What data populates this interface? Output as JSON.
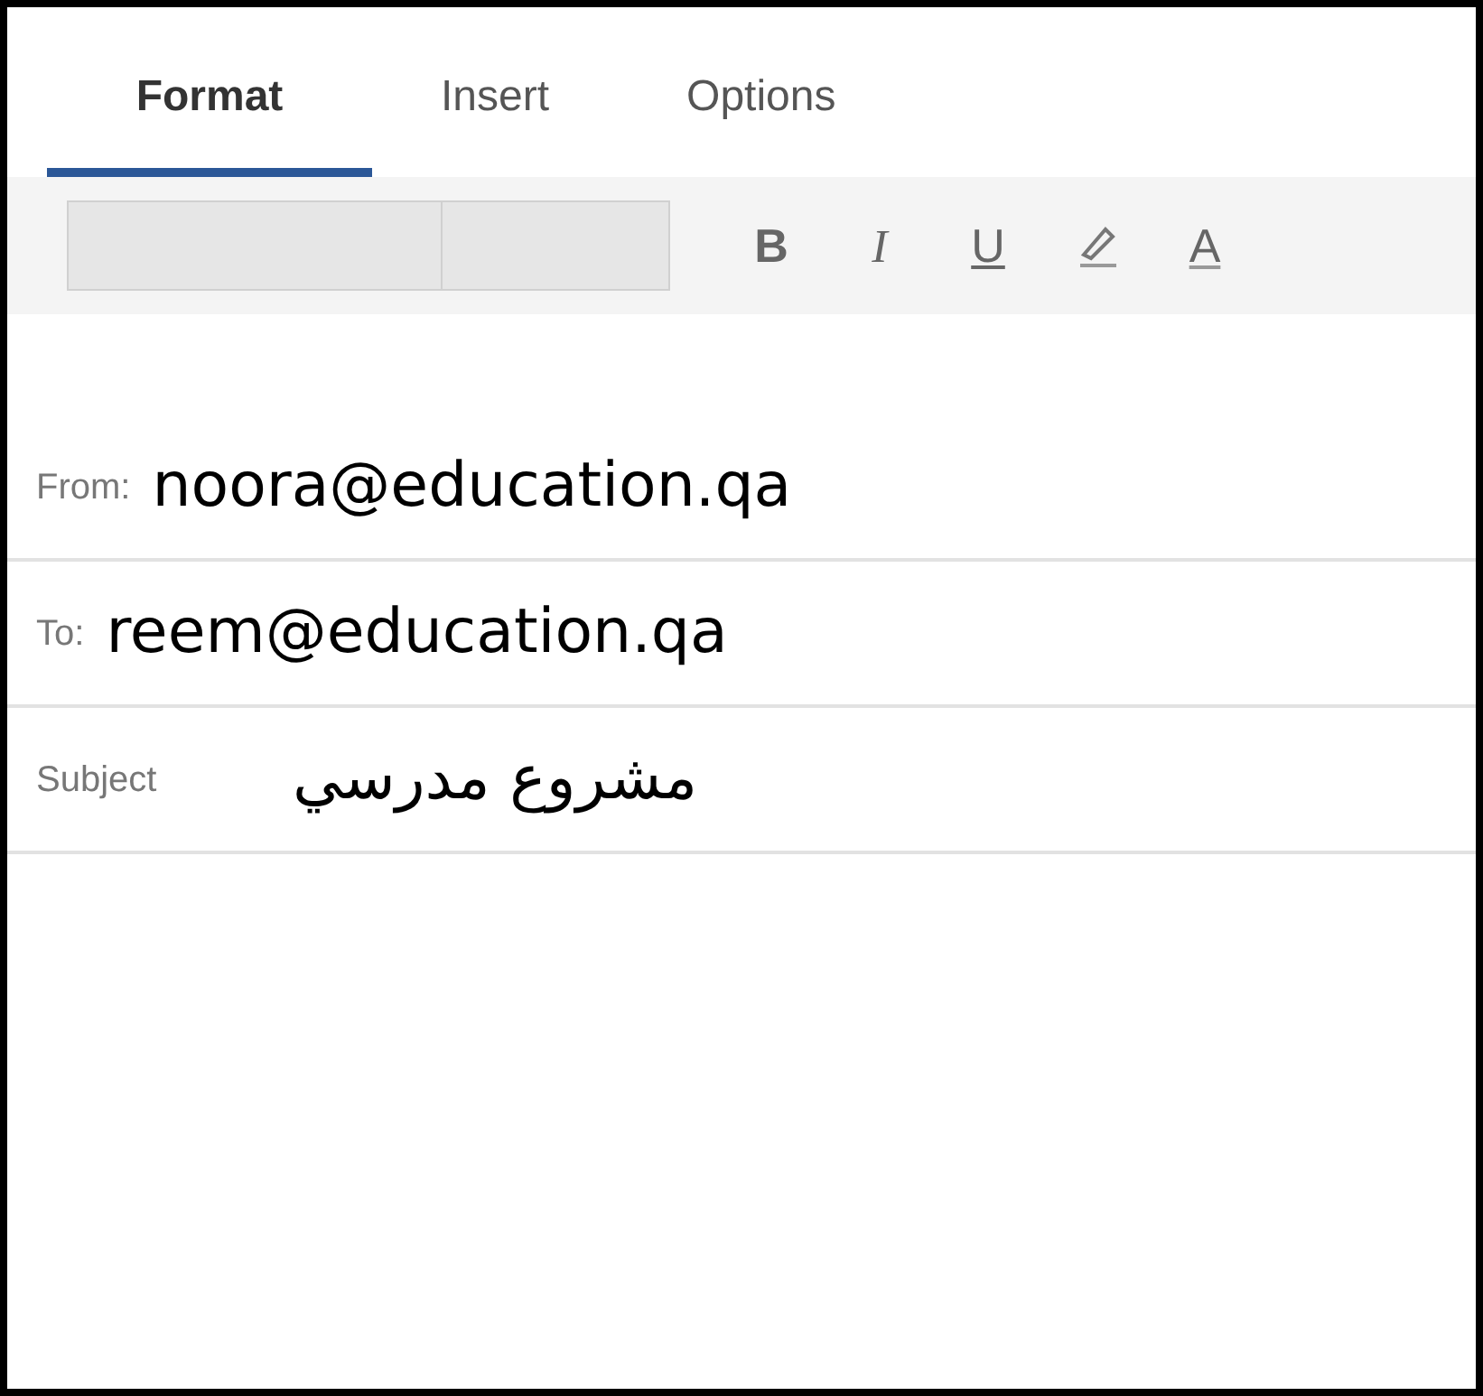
{
  "tabs": [
    {
      "label": "Format",
      "selected": true
    },
    {
      "label": "Insert",
      "selected": false
    },
    {
      "label": "Options",
      "selected": false
    }
  ],
  "toolbar": [
    {
      "kind": "bold",
      "label": "B"
    },
    {
      "kind": "italic",
      "label": "I"
    },
    {
      "kind": "underline",
      "label": "U"
    },
    {
      "kind": "highlighter"
    },
    {
      "kind": "fontcolor",
      "label": "A"
    }
  ],
  "fields": [
    {
      "label": "From:",
      "value": "noora@education.qa"
    },
    {
      "label": "To:",
      "value": "reem@education.qa"
    },
    {
      "label": "Subject",
      "value": "مشروع مدرسي"
    }
  ]
}
